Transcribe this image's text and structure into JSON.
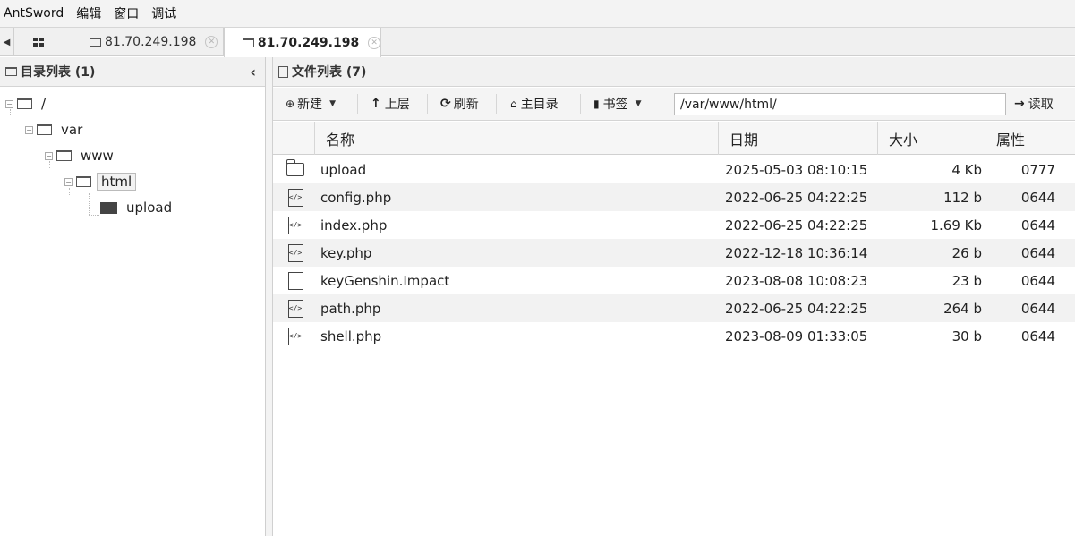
{
  "menu": {
    "items": [
      "AntSword",
      "编辑",
      "窗口",
      "调试"
    ]
  },
  "tabs": [
    {
      "label": "81.70.249.198",
      "active": false
    },
    {
      "label": "81.70.249.198",
      "active": true
    }
  ],
  "left_panel": {
    "title": "目录列表 (1)",
    "tree": [
      {
        "label": "/"
      },
      {
        "label": "var"
      },
      {
        "label": "www"
      },
      {
        "label": "html",
        "selected": true
      },
      {
        "label": "upload"
      }
    ]
  },
  "right_panel": {
    "title": "文件列表 (7)",
    "toolbar": {
      "new_label": "新建",
      "up_label": "上层",
      "refresh_label": "刷新",
      "home_label": "主目录",
      "bookmark_label": "书签",
      "path_value": "/var/www/html/",
      "read_label": "读取"
    },
    "columns": [
      "名称",
      "日期",
      "大小",
      "属性"
    ],
    "files": [
      {
        "icon": "folder-icon",
        "name": "upload",
        "date": "2025-05-03 08:10:15",
        "size": "4 Kb",
        "attr": "0777"
      },
      {
        "icon": "php-file-icon",
        "name": "config.php",
        "date": "2022-06-25 04:22:25",
        "size": "112 b",
        "attr": "0644"
      },
      {
        "icon": "php-file-icon",
        "name": "index.php",
        "date": "2022-06-25 04:22:25",
        "size": "1.69 Kb",
        "attr": "0644"
      },
      {
        "icon": "php-file-icon",
        "name": "key.php",
        "date": "2022-12-18 10:36:14",
        "size": "26 b",
        "attr": "0644"
      },
      {
        "icon": "file-icon",
        "name": "keyGenshin.Impact",
        "date": "2023-08-08 10:08:23",
        "size": "23 b",
        "attr": "0644"
      },
      {
        "icon": "php-file-icon",
        "name": "path.php",
        "date": "2022-06-25 04:22:25",
        "size": "264 b",
        "attr": "0644"
      },
      {
        "icon": "php-file-icon",
        "name": "shell.php",
        "date": "2023-08-09 01:33:05",
        "size": "30 b",
        "attr": "0644"
      }
    ]
  }
}
